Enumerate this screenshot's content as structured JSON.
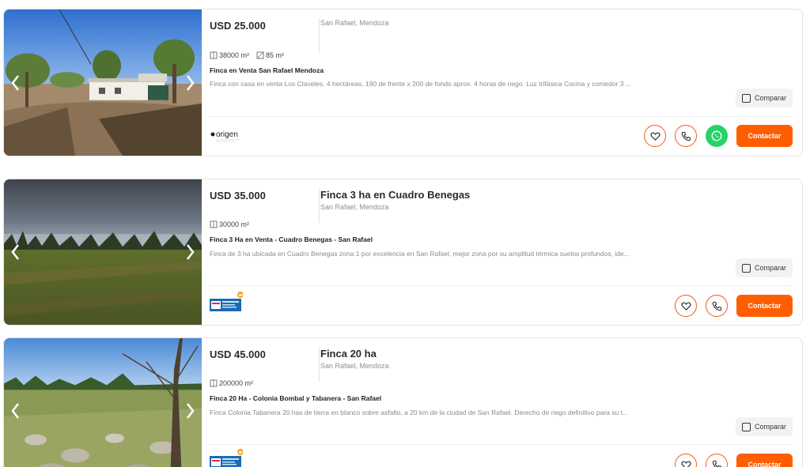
{
  "listings": [
    {
      "price": "USD 25.000",
      "title": "",
      "location": "San Rafael, Mendoza",
      "features": [
        {
          "icon": "land-area-icon",
          "value": "38000 m²"
        },
        {
          "icon": "covered-area-icon",
          "value": "85 m²"
        }
      ],
      "posting_title": "Finca en Venta San Rafael Mendoza",
      "description": "Finca con casa en venta Los Claveles. 4 hectáreas, 190 de frente x 200 de fondo aprox. 4 horas de riego. Luz trifásica Cocina y comedor 3 ...",
      "compare_label": "Comparar",
      "publisher_logo_text": "origen",
      "has_whatsapp": true,
      "contact_label": "Contactar"
    },
    {
      "price": "USD 35.000",
      "title": "Finca 3 ha en Cuadro Benegas",
      "location": "San Rafael, Mendoza",
      "features": [
        {
          "icon": "land-area-icon",
          "value": "30000 m²"
        }
      ],
      "posting_title": "Finca 3 Ha en Venta - Cuadro Benegas - San Rafael",
      "description": "Finca de 3 ha ubicada en Cuadro Benegas zona 1 por excelencia en San Rafael, mejor zona por su amplitud térmica suelos profundos, ide...",
      "compare_label": "Comparar",
      "has_whatsapp": false,
      "contact_label": "Contactar"
    },
    {
      "price": "USD 45.000",
      "title": "Finca 20 ha",
      "location": "San Rafael, Mendoza",
      "features": [
        {
          "icon": "land-area-icon",
          "value": "200000 m²"
        }
      ],
      "posting_title": "Finca 20 Ha - Colonia Bombal y Tabanera - San Rafael",
      "description": "Finca Colonia Tabanera 20 has de tierra en blanco sobre asfalto, a 20 km de la ciudad de San Rafael. Derecho de riego definitivo para su t...",
      "compare_label": "Comparar",
      "has_whatsapp": false,
      "contact_label": "Contactar"
    }
  ],
  "colors": {
    "accent": "#ff5e00",
    "whatsapp": "#25d366",
    "price_text": "#2b2b2b",
    "muted_text": "#8a8a8a"
  }
}
